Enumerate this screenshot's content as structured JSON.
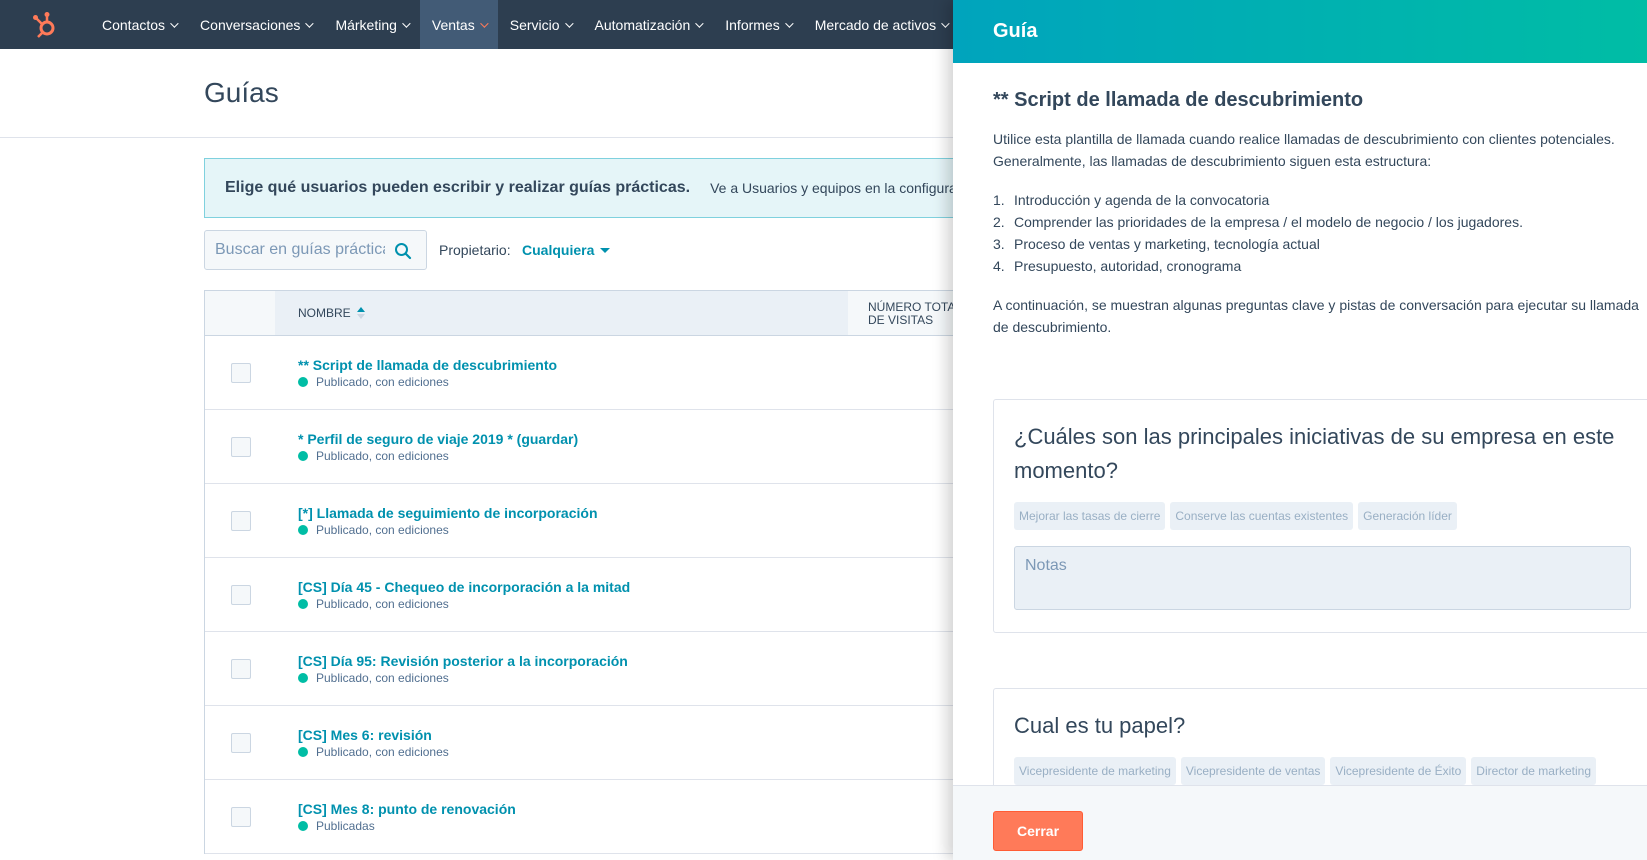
{
  "nav": {
    "logo_icon": "hubspot-sprocket-icon",
    "items": [
      {
        "label": "Contactos"
      },
      {
        "label": "Conversaciones"
      },
      {
        "label": "Márketing"
      },
      {
        "label": "Ventas"
      },
      {
        "label": "Servicio"
      },
      {
        "label": "Automatización"
      },
      {
        "label": "Informes"
      },
      {
        "label": "Mercado de activos"
      }
    ],
    "active": "Ventas"
  },
  "page": {
    "title": "Guías"
  },
  "banner": {
    "title": "Elige qué usuarios pueden escribir y realizar guías prácticas.",
    "link": "Ve a Usuarios y equipos en la configuración"
  },
  "filters": {
    "search_placeholder": "Buscar en guías prácticas",
    "owner_label": "Propietario:",
    "owner_value": "Cualquiera"
  },
  "table": {
    "columns": {
      "name": "NOMBRE",
      "visits_line1": "NÚMERO TOTAL",
      "visits_line2": "DE VISITAS"
    },
    "rows": [
      {
        "title": "** Script de llamada de descubrimiento",
        "status": "Publicado, con ediciones"
      },
      {
        "title": "* Perfil de seguro de viaje 2019 * (guardar)",
        "status": "Publicado, con ediciones"
      },
      {
        "title": "[*] Llamada de seguimiento de incorporación",
        "status": "Publicado, con ediciones"
      },
      {
        "title": "[CS] Día 45 - Chequeo de incorporación a la mitad",
        "status": "Publicado, con ediciones"
      },
      {
        "title": "[CS] Día 95: Revisión posterior a la incorporación",
        "status": "Publicado, con ediciones"
      },
      {
        "title": "[CS] Mes 6: revisión",
        "status": "Publicado, con ediciones"
      },
      {
        "title": "[CS] Mes 8: punto de renovación",
        "status": "Publicadas"
      }
    ]
  },
  "panel": {
    "header": "Guía",
    "guide_title": "** Script de llamada de descubrimiento",
    "intro": "Utilice esta plantilla de llamada cuando realice llamadas de descubrimiento con clientes potenciales. Generalmente, las llamadas de descubrimiento siguen esta estructura:",
    "steps": [
      {
        "num": "1.",
        "text": "Introducción y agenda de la convocatoria"
      },
      {
        "num": "2.",
        "text": "Comprender las prioridades de la empresa / el modelo de negocio / los jugadores."
      },
      {
        "num": "3.",
        "text": "Proceso de ventas y marketing, tecnología actual"
      },
      {
        "num": "4.",
        "text": "Presupuesto, autoridad, cronograma"
      }
    ],
    "continuation": "A continuación, se muestran algunas preguntas clave y pistas de conversación para ejecutar su llamada de descubrimiento.",
    "questions": [
      {
        "title": "¿Cuáles son las principales iniciativas de su empresa en este momento?",
        "chips": [
          "Mejorar las tasas de cierre",
          "Conserve las cuentas existentes",
          "Generación líder"
        ],
        "notes_placeholder": "Notas"
      },
      {
        "title": "Cual es tu papel?",
        "chips": [
          "Vicepresidente de marketing",
          "Vicepresidente de ventas",
          "Vicepresidente de Éxito",
          "Director de marketing"
        ]
      }
    ],
    "close_label": "Cerrar"
  },
  "colors": {
    "nav_bg": "#2d3e50",
    "accent_teal": "#0091ae",
    "cta_orange": "#ff7a59",
    "status_green": "#00bda5"
  }
}
